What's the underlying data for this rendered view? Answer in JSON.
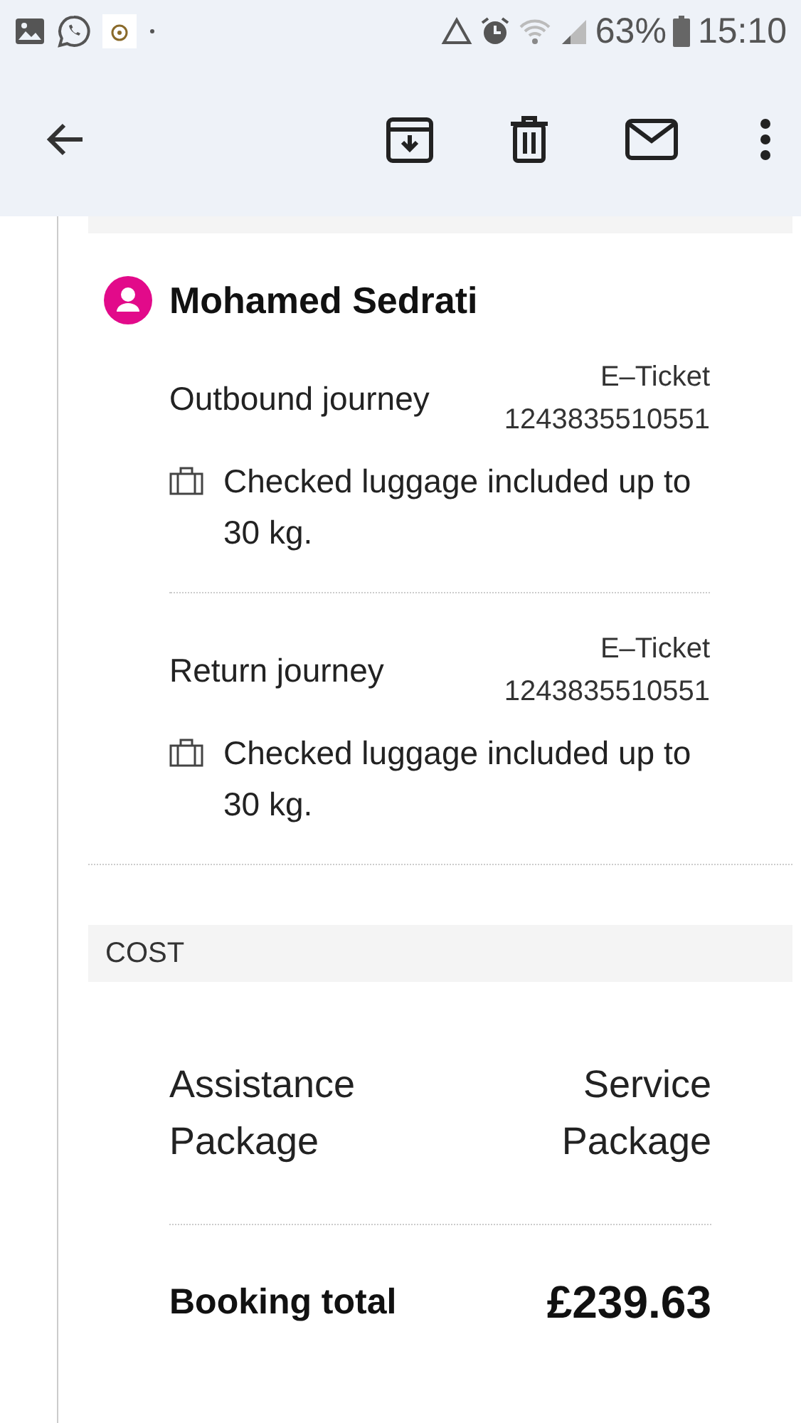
{
  "status_bar": {
    "battery": "63%",
    "time": "15:10"
  },
  "passenger": {
    "name": "Mohamed Sedrati",
    "journeys": [
      {
        "label": "Outbound journey",
        "ticket_label": "E–Ticket",
        "ticket_number": "1243835510551",
        "luggage": "Checked luggage included up to 30 kg."
      },
      {
        "label": "Return journey",
        "ticket_label": "E–Ticket",
        "ticket_number": "1243835510551",
        "luggage": "Checked luggage included up to 30 kg."
      }
    ]
  },
  "cost": {
    "heading": "COST",
    "rows": [
      {
        "label": "Assistance Package",
        "value": "Service Package"
      }
    ],
    "total": {
      "label": "Booking total",
      "amount": "£239.63"
    }
  }
}
